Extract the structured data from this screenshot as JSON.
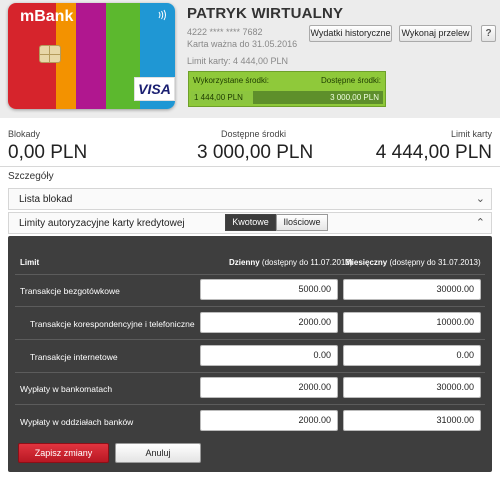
{
  "card": {
    "brand": "mBank",
    "network": "VISA",
    "holder": "PATRYK WIRTUALNY",
    "number": "4222 **** **** 7682",
    "valid_until": "Karta ważna do 31.05.2016",
    "limit_text": "Limit karty: 4 444,00 PLN",
    "stripe_colors": [
      "#d6242c",
      "#f39200",
      "#b0178f",
      "#5cb82e",
      "#1f97d4"
    ],
    "icons": {
      "contactless": "contactless-icon",
      "chip": "chip-icon"
    }
  },
  "header_buttons": {
    "history": "Wydatki historyczne",
    "transfer": "Wykonaj przelew",
    "help": "?"
  },
  "usage": {
    "used_label": "Wykorzystane środki:",
    "available_label": "Dostępne środki:",
    "used_value": "1 444,00 PLN",
    "available_value": "3 000,00 PLN",
    "used_fraction": 0.325
  },
  "balances": {
    "blocks_label": "Blokady",
    "blocks_value": "0,00 PLN",
    "available_label": "Dostępne środki",
    "available_value": "3 000,00 PLN",
    "limit_label": "Limit karty",
    "limit_value": "4 444,00 PLN"
  },
  "details": {
    "label": "Szczegóły",
    "locks_list": "Lista blokad",
    "limits_title": "Limity autoryzacyjne karty kredytowej",
    "seg_amount": "Kwotowe",
    "seg_count": "Ilościowe"
  },
  "limits_table": {
    "header_limit": "Limit",
    "header_daily_bold": "Dzienny",
    "header_daily_rest": "(dostępny do 11.07.2013)",
    "header_monthly_bold": "Miesięczny",
    "header_monthly_rest": "(dostępny do 31.07.2013)",
    "rows": [
      {
        "label": "Transakcje bezgotówkowe",
        "daily": "5000.00",
        "monthly": "30000.00"
      },
      {
        "label": "Transakcje korespondencyjne i telefoniczne",
        "daily": "2000.00",
        "monthly": "10000.00"
      },
      {
        "label": "Transakcje internetowe",
        "daily": "0.00",
        "monthly": "0.00"
      },
      {
        "label": "Wypłaty w bankomatach",
        "daily": "2000.00",
        "monthly": "30000.00"
      },
      {
        "label": "Wypłaty w oddziałach banków",
        "daily": "2000.00",
        "monthly": "31000.00"
      }
    ],
    "save": "Zapisz zmiany",
    "cancel": "Anuluj"
  }
}
